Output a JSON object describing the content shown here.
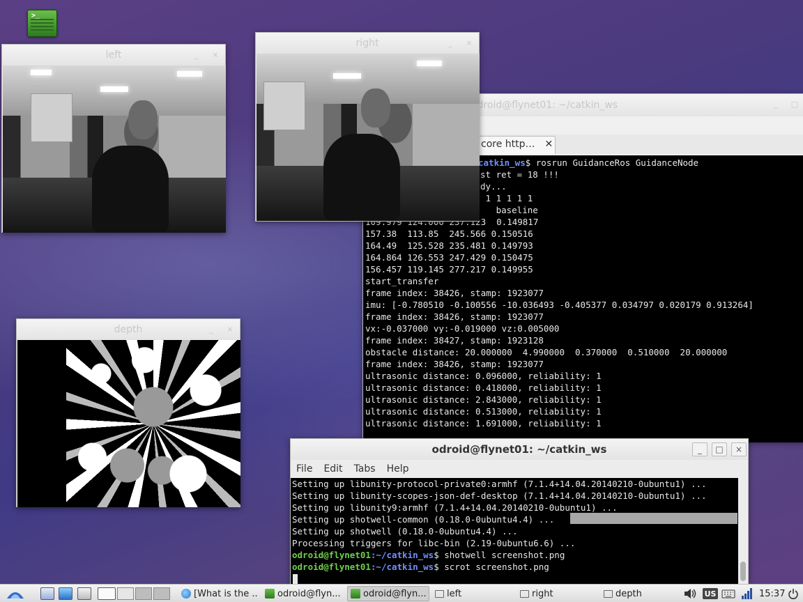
{
  "desktop": {
    "icon_name": "terminal-icon",
    "prompt_glyph": ">_"
  },
  "windows": {
    "left": {
      "title": "left",
      "min": "_",
      "close": "×"
    },
    "right": {
      "title": "right",
      "min": "_",
      "close": "×"
    },
    "depth": {
      "title": "depth",
      "min": "_",
      "close": "×"
    },
    "term_back": {
      "title": "odroid@flynet01: ~/catkin_ws",
      "min": "_",
      "max": "□",
      "tab_label": "core http…",
      "tab_close": "✕",
      "prompt_path": "catkin_ws",
      "cmd": "$ rosrun GuidanceRos GuidanceNode",
      "lines": [
        "st ret = 18 !!!",
        "dy...",
        " 1 1 1 1 1",
        "   baseline",
        "157.38  113.85  245.566 0.150516",
        "164.49  125.528 235.481 0.149793",
        "164.864 126.553 247.429 0.150475",
        "156.457 119.145 277.217 0.149955",
        "start_transfer",
        "frame index: 38426, stamp: 1923077",
        "imu: [-0.780510 -0.100556 -10.036493 -0.405377 0.034797 0.020179 0.913264]",
        "frame index: 38426, stamp: 1923077",
        "vx:-0.037000 vy:-0.019000 vz:0.005000",
        "frame index: 38427, stamp: 1923128",
        "obstacle distance: 20.000000  4.990000  0.370000  0.510000  20.000000",
        "frame index: 38426, stamp: 1923077",
        "ultrasonic distance: 0.096000, reliability: 1",
        "ultrasonic distance: 0.418000, reliability: 1",
        "ultrasonic distance: 2.843000, reliability: 1",
        "ultrasonic distance: 0.513000, reliability: 1",
        "ultrasonic distance: 1.691000, reliability: 1"
      ],
      "partial_row": "109.979 124.000 237.123  0.149817"
    },
    "term_front": {
      "title": "odroid@flynet01: ~/catkin_ws",
      "min": "_",
      "max": "□",
      "close": "×",
      "menu": [
        "File",
        "Edit",
        "Tabs",
        "Help"
      ],
      "lines": [
        "Setting up libunity-protocol-private0:armhf (7.1.4+14.04.20140210-0ubuntu1) ...",
        "Setting up libunity-scopes-json-def-desktop (7.1.4+14.04.20140210-0ubuntu1) ...",
        "Setting up libunity9:armhf (7.1.4+14.04.20140210-0ubuntu1) ...",
        "Setting up shotwell-common (0.18.0-0ubuntu4.4) ...",
        "Setting up shotwell (0.18.0-0ubuntu4.4) ...",
        "Processing triggers for libc-bin (2.19-0ubuntu6.6) ..."
      ],
      "prompt_user": "odroid@flynet01",
      "prompt_path": ":~/catkin_ws",
      "cmd1": "$ shotwell screenshot.png",
      "cmd2": "$ scrot screenshot.png"
    }
  },
  "taskbar": {
    "tasks": [
      {
        "label": "[What is the ...",
        "icon": "globe-icon"
      },
      {
        "label": "odroid@flyn...",
        "icon": "terminal-icon"
      },
      {
        "label": "odroid@flyn...",
        "icon": "terminal-icon"
      },
      {
        "label": "left",
        "icon": "folder-icon"
      },
      {
        "label": "right",
        "icon": "folder-icon"
      },
      {
        "label": "depth",
        "icon": "folder-icon"
      }
    ],
    "keyboard_layout": "US",
    "clock": "15:37"
  }
}
